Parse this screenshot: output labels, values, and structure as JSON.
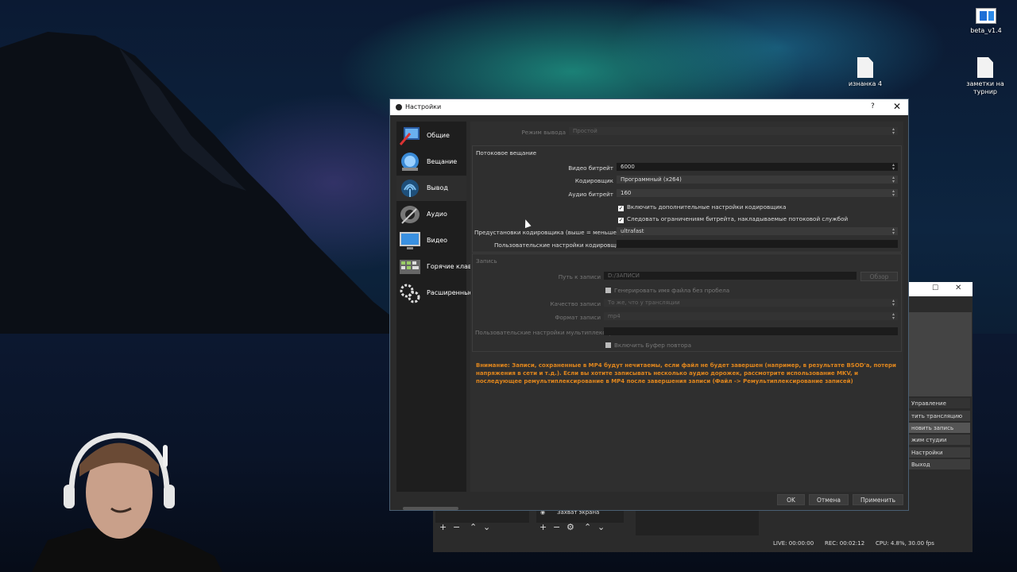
{
  "desktop": {
    "icons": [
      {
        "label": "beta_v1.4",
        "icon": "app-icon"
      },
      {
        "label": "изнанка 4",
        "icon": "file-icon"
      },
      {
        "label": "заметки на турнир",
        "icon": "file-icon"
      }
    ]
  },
  "dialog": {
    "title": "Настройки",
    "help": "?",
    "close": "✕",
    "sidebar": [
      {
        "label": "Общие",
        "icon": "general-icon"
      },
      {
        "label": "Вещание",
        "icon": "stream-icon"
      },
      {
        "label": "Вывод",
        "icon": "output-icon"
      },
      {
        "label": "Аудио",
        "icon": "audio-icon"
      },
      {
        "label": "Видео",
        "icon": "video-icon"
      },
      {
        "label": "Горячие клави",
        "icon": "hotkeys-icon"
      },
      {
        "label": "Расширенные",
        "icon": "advanced-icon"
      }
    ],
    "output_mode": {
      "label": "Режим вывода",
      "value": "Простой"
    },
    "streaming": {
      "title": "Потоковое вещание",
      "video_bitrate": {
        "label": "Видео битрейт",
        "value": "6000"
      },
      "encoder": {
        "label": "Кодировщик",
        "value": "Программный (x264)"
      },
      "audio_bitrate": {
        "label": "Аудио битрейт",
        "value": "160"
      },
      "advanced_check": {
        "label": "Включить дополнительные настройки кодировщика",
        "checked": true
      },
      "enforce_check": {
        "label": "Следовать ограничениям битрейта, накладываемые потоковой службой",
        "checked": true
      },
      "preset": {
        "label": "Предустановки кодировщика (выше = меньше ЦП)",
        "value": "ultrafast"
      },
      "custom": {
        "label": "Пользовательские настройки кодировщика",
        "value": ""
      }
    },
    "recording": {
      "title": "Запись",
      "path": {
        "label": "Путь к записи",
        "value": "D:/ЗАПИСИ",
        "browse": "Обзор"
      },
      "nospace_check": {
        "label": "Генерировать имя файла без пробела",
        "checked": false
      },
      "quality": {
        "label": "Качество записи",
        "value": "То же, что у трансляции"
      },
      "format": {
        "label": "Формат записи",
        "value": "mp4"
      },
      "muxer": {
        "label": "Пользовательские настройки мультиплексора",
        "value": ""
      },
      "replay_check": {
        "label": "Включить Буфер повтора",
        "checked": false
      }
    },
    "warning": "Внимание: Записи, сохраненные в MP4 будут нечитаемы, если файл не будет завершен (например, в результате BSOD'а, потери напряжения в сети и т.д.). Если вы хотите записывать несколько аудио дорожек, рассмотрите использование MKV, и последующее ремультиплексирование в MP4 после завершения записи (Файл -> Ремультиплексирование записей)",
    "buttons": {
      "ok": "OK",
      "cancel": "Отмена",
      "apply": "Применить"
    }
  },
  "obs_main": {
    "controls_title": "Управление",
    "controls": [
      "тить трансляцию",
      "новить запись",
      "жим студии",
      "Настройки",
      "Выход"
    ],
    "source_item": "Захват экрана",
    "status": {
      "live": "LIVE: 00:00:00",
      "rec": "REC: 00:02:12",
      "cpu": "CPU: 4.8%, 30.00 fps"
    },
    "window_controls": {
      "maximize": "☐",
      "close": "✕"
    }
  }
}
